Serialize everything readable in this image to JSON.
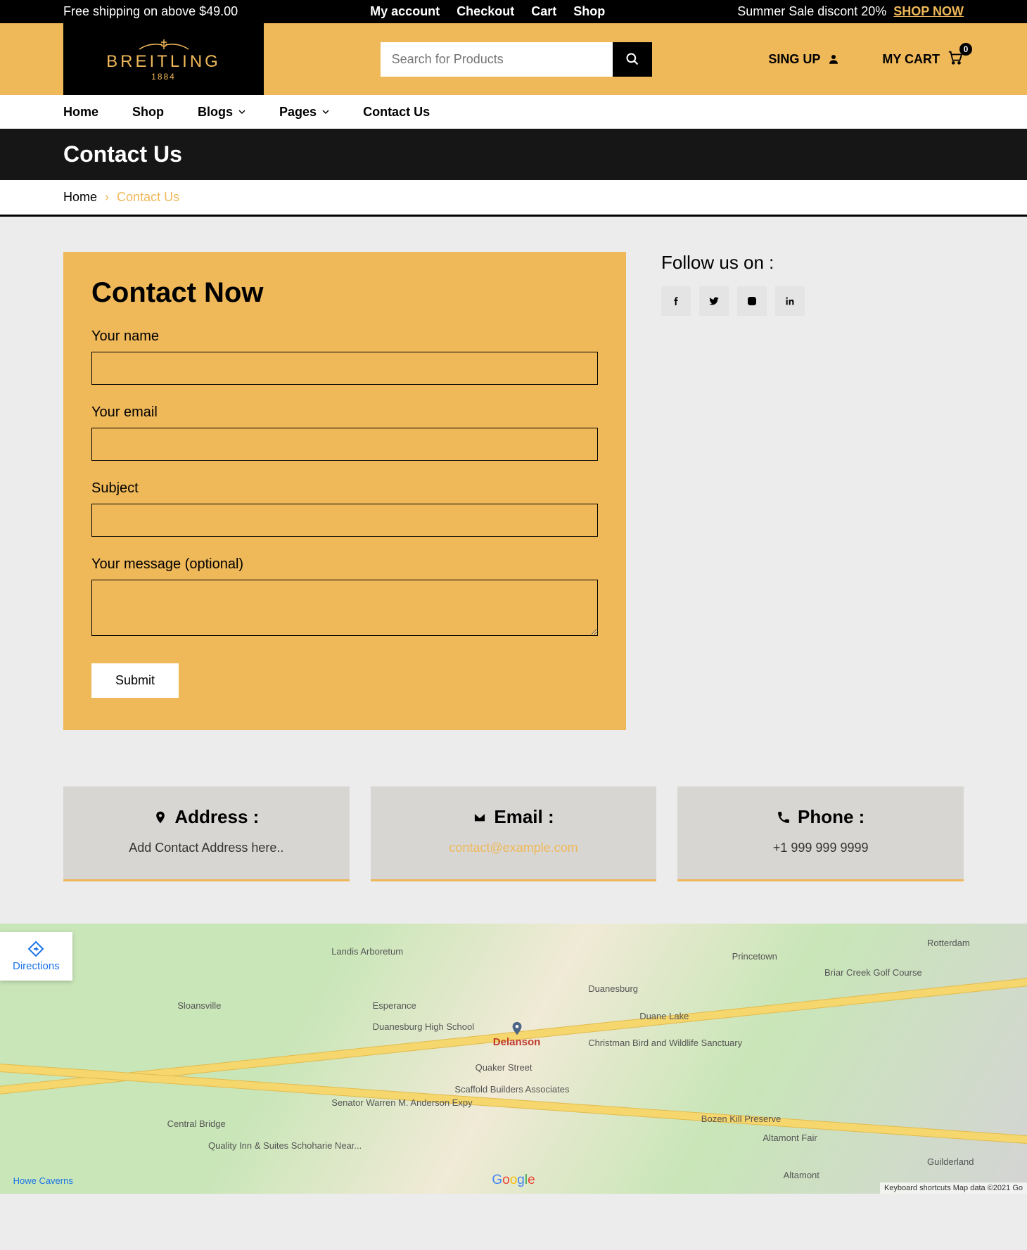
{
  "topbar": {
    "shipping_text": "Free shipping on above $49.00",
    "links": [
      "My account",
      "Checkout",
      "Cart",
      "Shop"
    ],
    "promo_text": "Summer Sale discont 20%",
    "shop_now": "SHOP NOW"
  },
  "logo": {
    "name": "BREITLING",
    "year": "1884"
  },
  "search": {
    "placeholder": "Search for Products"
  },
  "header_actions": {
    "signup": "SING UP",
    "my_cart": "MY CART",
    "cart_count": "0"
  },
  "nav": {
    "items": [
      "Home",
      "Shop",
      "Blogs",
      "Pages",
      "Contact Us"
    ]
  },
  "titlebar": {
    "title": "Contact Us"
  },
  "breadcrumb": {
    "home": "Home",
    "current": "Contact Us"
  },
  "form": {
    "heading": "Contact Now",
    "name_label": "Your name",
    "email_label": "Your email",
    "subject_label": "Subject",
    "message_label": "Your message (optional)",
    "submit": "Submit"
  },
  "follow": {
    "title": "Follow us on :",
    "socials": [
      "facebook",
      "twitter",
      "instagram",
      "linkedin"
    ]
  },
  "info": {
    "address_title": "Address :",
    "address_value": "Add Contact Address here..",
    "email_title": "Email :",
    "email_value": "contact@example.com",
    "phone_title": "Phone :",
    "phone_value": "+1 999 999 9999"
  },
  "map": {
    "directions": "Directions",
    "pin": "Delanson",
    "labels": {
      "l1": "Landis Arboretum",
      "l2": "Esperance",
      "l3": "Sloansville",
      "l4": "Duanesburg High School",
      "l5": "Quaker Street",
      "l6": "Central Bridge",
      "l7": "Duanesburg",
      "l8": "Christman Bird and Wildlife Sanctuary",
      "l9": "Briar Creek Golf Course",
      "l10": "Princetown",
      "l11": "Rotterdam",
      "l12": "Guilderland",
      "l13": "Altamont",
      "l14": "Scaffold Builders Associates",
      "l15": "Bozen Kill Preserve",
      "l16": "Altamont Fair",
      "l17": "Quality Inn & Suites Schoharie Near...",
      "l18": "Howe Caverns",
      "l19": "Duane Lake",
      "l20": "Senator Warren M. Anderson Expy"
    },
    "attribution": "Keyboard shortcuts   Map data ©2021 Go"
  }
}
